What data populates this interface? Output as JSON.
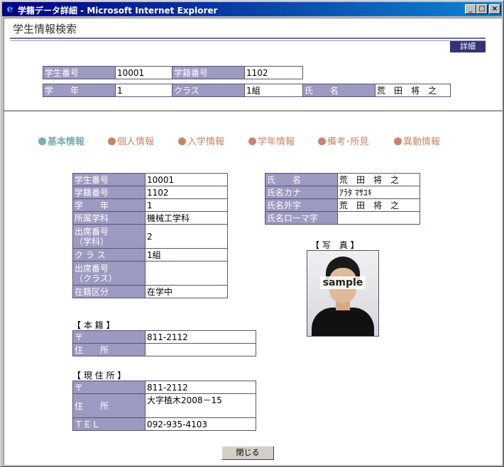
{
  "window": {
    "title": "学籍データ詳細 - Microsoft Internet Explorer"
  },
  "header": {
    "page_title": "学生情報検索",
    "detail_button": "詳細"
  },
  "summary": {
    "student_no_label": "学生番号",
    "student_no": "10001",
    "reg_no_label": "学籍番号",
    "reg_no": "1102",
    "grade_label": "学　　年",
    "grade": "1",
    "class_label": "クラス",
    "class": "1組",
    "name_label": "氏　　名",
    "name": "荒　田　将　之"
  },
  "tabs": [
    "基本情報",
    "個人情報",
    "入学情報",
    "学年情報",
    "備考･所見",
    "異動情報"
  ],
  "basic": {
    "rows": [
      {
        "label": "学生番号",
        "value": "10001"
      },
      {
        "label": "学籍番号",
        "value": "1102"
      },
      {
        "label": "学　　年",
        "value": "1"
      },
      {
        "label": "所属学科",
        "value": "機械工学科"
      },
      {
        "label": "出席番号\n（学科）",
        "value": "2"
      },
      {
        "label": "ク ラ ス",
        "value": "1組"
      },
      {
        "label": "出席番号\n（クラス）",
        "value": ""
      },
      {
        "label": "在籍区分",
        "value": "在学中"
      }
    ]
  },
  "names": {
    "rows": [
      {
        "label": "氏　　名",
        "value": "荒　田　将　之"
      },
      {
        "label": "氏名カナ",
        "value": "ｱﾗﾀ ﾏｻﾕｷ"
      },
      {
        "label": "氏名外字",
        "value": "荒　田　将　之"
      },
      {
        "label": "氏名ローマ字",
        "value": ""
      }
    ]
  },
  "photo": {
    "label": "【 写　真 】",
    "watermark": "sample"
  },
  "honseki": {
    "heading": "【 本 籍 】",
    "zip_label": "〒",
    "zip": "811-2112",
    "addr_label": "住　　所",
    "addr": ""
  },
  "current": {
    "heading": "【 現 住 所 】",
    "zip_label": "〒",
    "zip": "811-2112",
    "addr_label": "住　　所",
    "addr": "大字植木2008－15",
    "tel_label": "ＴＥＬ",
    "tel": "092-935-4103"
  },
  "footer": {
    "close_button": "閉じる"
  },
  "colors": {
    "label_bg": "#9c9ac0",
    "tab_active": "#7aacb2",
    "tab_inactive": "#c8846a",
    "title_bar": "#000080"
  }
}
